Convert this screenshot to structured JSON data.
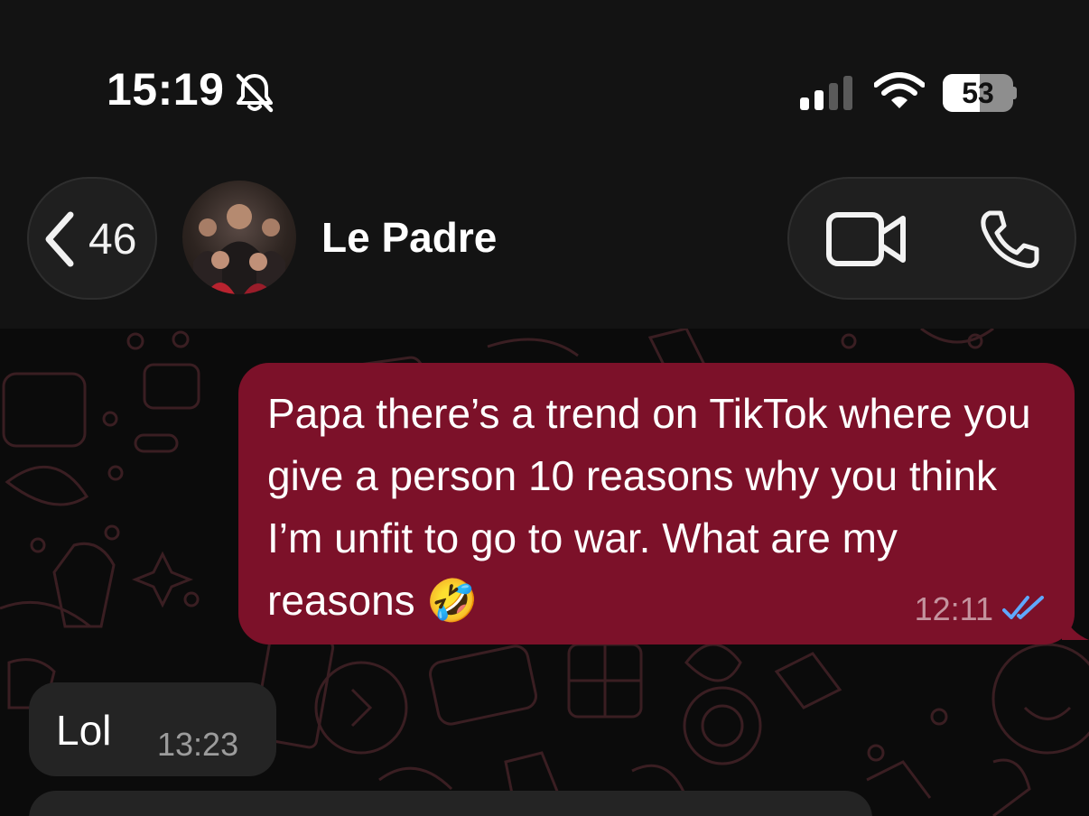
{
  "status_bar": {
    "time": "15:19",
    "silent_icon": "bell-slash-icon",
    "battery_level": "53",
    "battery_fraction": 0.53
  },
  "header": {
    "back_count": "46",
    "contact_name": "Le Padre",
    "back_icon": "chevron-left-icon",
    "video_icon": "video-camera-icon",
    "phone_icon": "phone-icon"
  },
  "messages": [
    {
      "direction": "outgoing",
      "text": "Papa there’s a trend on TikTok where you give a person 10 reasons why you think I’m unfit to go to war. What are my reasons 🤣",
      "time": "12:11",
      "status_icon": "double-check-read-icon"
    },
    {
      "direction": "incoming",
      "text": "Lol",
      "time": "13:23"
    }
  ],
  "colors": {
    "outgoing_bubble": "#7c1129",
    "incoming_bubble": "#242424",
    "read_ticks": "#5fa8ff",
    "header_bg": "#131313"
  }
}
